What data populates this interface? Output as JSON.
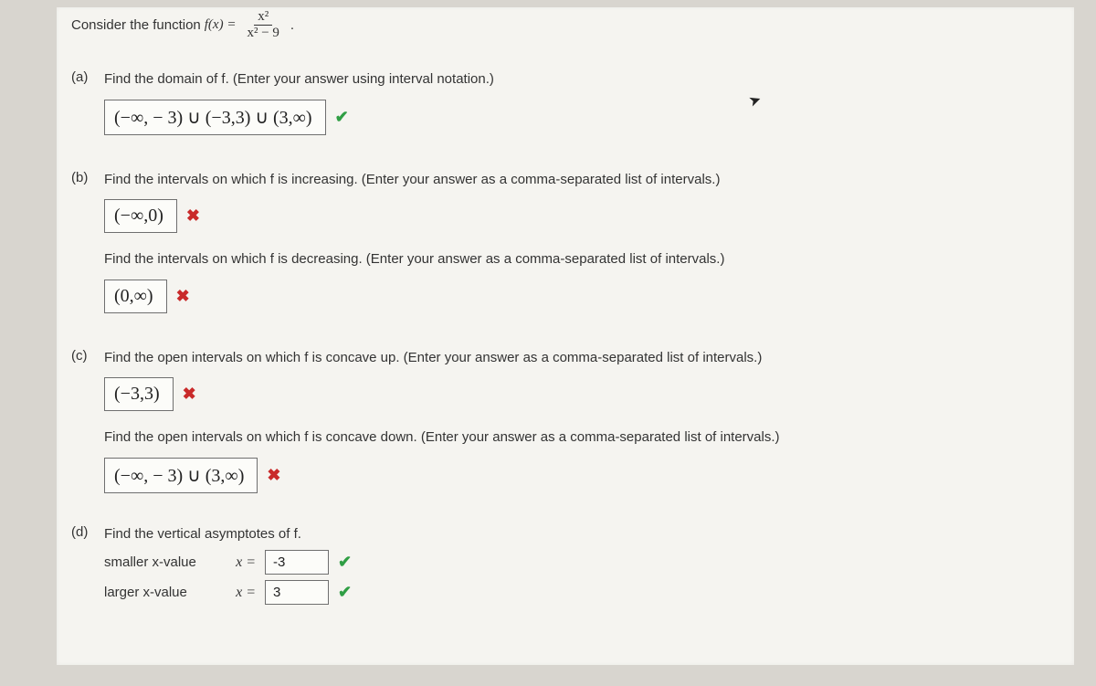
{
  "intro": {
    "prefix": "Consider the function ",
    "func_lhs": "f(x) =",
    "frac_num": "x²",
    "frac_den": "x² − 9",
    "period": "."
  },
  "parts": {
    "a": {
      "label": "(a)",
      "prompt": "Find the domain of f. (Enter your answer using interval notation.)",
      "answer": "(−∞, − 3) ∪ (−3,3) ∪ (3,∞)",
      "mark": "correct"
    },
    "b": {
      "label": "(b)",
      "prompt1": "Find the intervals on which f is increasing. (Enter your answer as a comma-separated list of intervals.)",
      "answer1": "(−∞,0)",
      "mark1": "wrong",
      "prompt2": "Find the intervals on which f is decreasing. (Enter your answer as a comma-separated list of intervals.)",
      "answer2": "(0,∞)",
      "mark2": "wrong"
    },
    "c": {
      "label": "(c)",
      "prompt1": "Find the open intervals on which f is concave up. (Enter your answer as a comma-separated list of intervals.)",
      "answer1": "(−3,3)",
      "mark1": "wrong",
      "prompt2": "Find the open intervals on which f is concave down. (Enter your answer as a comma-separated list of intervals.)",
      "answer2": "(−∞, − 3) ∪ (3,∞)",
      "mark2": "wrong"
    },
    "d": {
      "label": "(d)",
      "prompt": "Find the vertical asymptotes of f.",
      "smaller_label": "smaller x-value",
      "larger_label": "larger x-value",
      "xeq": "x =",
      "smaller_val": "-3",
      "larger_val": "3",
      "smaller_mark": "correct",
      "larger_mark": "correct"
    }
  },
  "marks": {
    "correct": "✔",
    "wrong": "✖"
  }
}
